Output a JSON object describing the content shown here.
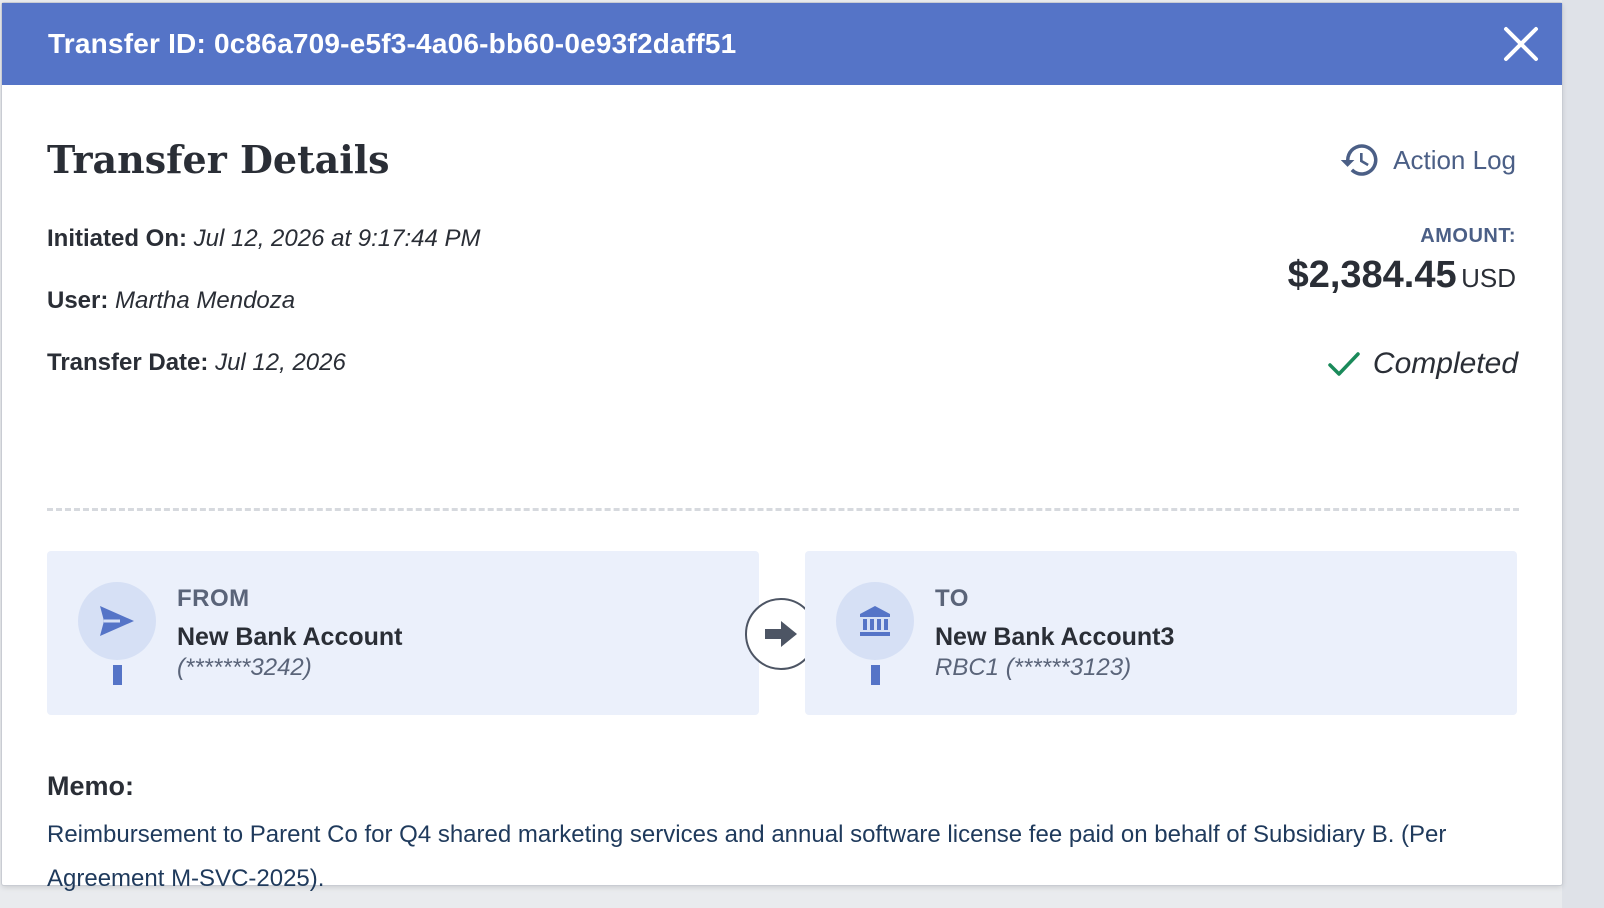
{
  "header": {
    "title": "Transfer ID: 0c86a709-e5f3-4a06-bb60-0e93f2daff51"
  },
  "details": {
    "title": "Transfer Details",
    "action_log_label": "Action Log",
    "initiated_label": "Initiated On:",
    "initiated_value": "Jul 12, 2026 at 9:17:44 PM",
    "user_label": "User:",
    "user_value": "Martha Mendoza",
    "transfer_date_label": "Transfer Date:",
    "transfer_date_value": "Jul 12, 2026"
  },
  "amount": {
    "label": "AMOUNT:",
    "value": "$2,384.45",
    "currency": "USD"
  },
  "status": {
    "label": "Completed",
    "color": "#1a8a5a"
  },
  "from": {
    "label": "FROM",
    "name": "New Bank Account",
    "sub": "(*******3242)",
    "icon": "send-icon"
  },
  "to": {
    "label": "TO",
    "name": "New Bank Account3",
    "sub": "RBC1 (******3123)",
    "icon": "bank-icon"
  },
  "memo": {
    "label": "Memo:",
    "text": "Reimbursement to Parent Co for Q4 shared marketing services and annual software license fee paid on behalf of Subsidiary B. (Per Agreement M-SVC-2025)."
  },
  "colors": {
    "header": "#5574c7",
    "accent": "#5574c7",
    "card_bg": "#ebf0fb"
  }
}
